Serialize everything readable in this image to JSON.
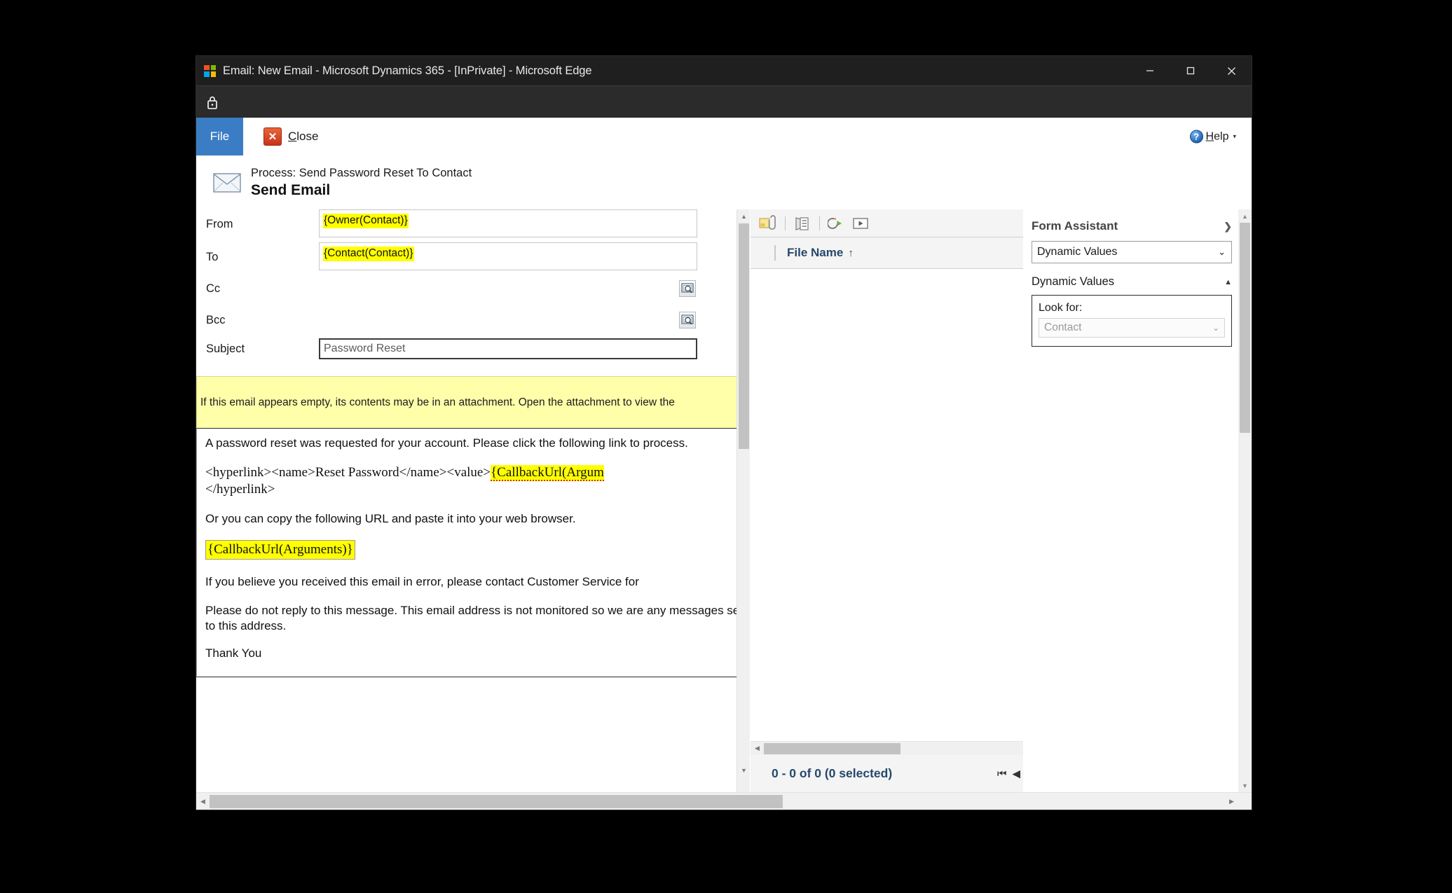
{
  "window": {
    "title": "Email: New Email - Microsoft Dynamics 365 - [InPrivate] - Microsoft Edge",
    "minimize_label": "—",
    "maximize_label": "☐",
    "close_label": "✕",
    "private_icon": "lock-icon"
  },
  "ribbon": {
    "file_label": "File",
    "close_label_prefix": "C",
    "close_label_rest": "lose",
    "close_icon": "close-x-icon",
    "help_label_prefix": "H",
    "help_label_rest": "elp",
    "help_icon": "help-circle-icon",
    "help_caret": "▾"
  },
  "record": {
    "icon": "envelope-icon",
    "process_line": "Process: Send Password Reset To Contact",
    "title": "Send Email"
  },
  "form": {
    "fields": [
      {
        "label": "From",
        "value": "{Owner(Contact)}",
        "highlighted": true,
        "lookup": false
      },
      {
        "label": "To",
        "value": "{Contact(Contact)}",
        "highlighted": true,
        "lookup": false
      },
      {
        "label": "Cc",
        "value": "",
        "highlighted": false,
        "lookup": true
      },
      {
        "label": "Bcc",
        "value": "",
        "highlighted": false,
        "lookup": true
      }
    ],
    "subject": {
      "label": "Subject",
      "value": "Password Reset"
    },
    "notice": "If this email appears empty, its contents may be in an attachment. Open the attachment to view the",
    "body": {
      "p1": "A password reset was requested for your account. Please click the following link to",
      "p1b": "process.",
      "p2_prefix": "<hyperlink><name>Reset Password</name><value>",
      "p2_token": "{CallbackUrl(Argum",
      "p2_suffix": "</hyperlink>",
      "p3": "Or you can copy the following URL and paste it into your web browser.",
      "p4_token": "{CallbackUrl(Arguments)}",
      "p5": "If you believe you received this email in error, please contact Customer Service for",
      "p6": "Please do not reply to this message. This email address is not monitored so we are",
      "p6b": "any messages sent to this address.",
      "p7": "Thank You"
    }
  },
  "attachments": {
    "toolbar_icons": [
      "attach-file-icon",
      "insert-article-icon",
      "insert-template-icon",
      "run-video-icon"
    ],
    "column_header": "File Name",
    "sort_arrow": "↑",
    "count_label": "0 - 0 of 0 (0 selected)",
    "pager_first": "⏮",
    "pager_prev": "◀"
  },
  "assistant": {
    "title": "Form Assistant",
    "expand_icon": "❯",
    "selected_view": "Dynamic Values",
    "section_title": "Dynamic Values",
    "collapse_icon": "▲",
    "lookfor_label": "Look for:",
    "lookfor_value": "Contact",
    "chevron_down": "⌄"
  },
  "scroll": {
    "arrow_up": "▲",
    "arrow_down": "▼",
    "arrow_left": "◀",
    "arrow_right": "▶"
  },
  "colors": {
    "accent_blue": "#3b7dc4",
    "highlight_yellow": "#ffff00",
    "notice_yellow": "#ffffaa",
    "header_blue_text": "#26486b",
    "titlebar": "#1f1f1f"
  }
}
